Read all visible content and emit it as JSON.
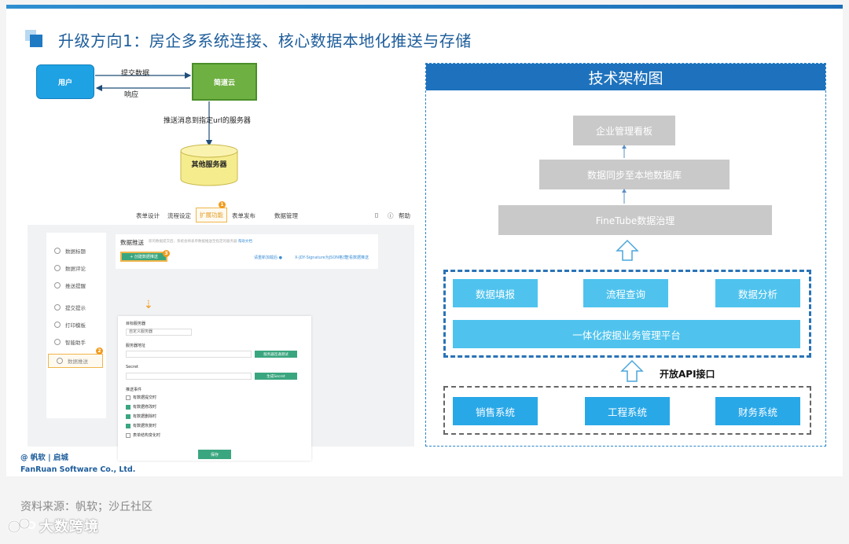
{
  "slide": {
    "title": "升级方向1：房企多系统连接、核心数据本地化推送与存储"
  },
  "flow": {
    "user": "用户",
    "cloud": "简道云",
    "submit": "提交数据",
    "response": "响应",
    "push": "推送消息到指定url的服务器",
    "server": "其他服务器"
  },
  "screenshot": {
    "tabs": [
      "表单设计",
      "流程设定",
      "扩展功能",
      "表单发布",
      "数据管理"
    ],
    "help": "帮助",
    "badge1": "1",
    "badge2": "2",
    "badge3": "3",
    "side_items": [
      "数据标题",
      "数据评论",
      "推送提醒",
      "提交提示",
      "打印模板",
      "智能助手",
      "数据推送"
    ],
    "panel_title": "数据推送",
    "panel_desc": "新的数据提交后，系统会将表单数据推送至指定的服务器",
    "panel_desc_link": "帮助文档",
    "push_button": "+ 创建数据推送",
    "panel_links": [
      "请重新加载后 ●",
      "X-JDY-Signature为JSON格式",
      "查看数据推送"
    ],
    "form": {
      "server_label": "目标服务器",
      "server_value": "自定义服务器",
      "url_label": "服务器地址",
      "test_button": "服务器连通测试",
      "secret_label": "Secret",
      "secret_button": "生成Secret",
      "events_label": "推送事件",
      "events": [
        {
          "label": "有数据提交时",
          "checked": false
        },
        {
          "label": "有数据修改时",
          "checked": true
        },
        {
          "label": "有数据删除时",
          "checked": true
        },
        {
          "label": "有数据恢复时",
          "checked": true
        },
        {
          "label": "表单结构变化时",
          "checked": false
        }
      ],
      "save": "保存"
    }
  },
  "brand": {
    "line1": "@ 帆软 | 启城",
    "line2": "FanRuan  Software Co., Ltd."
  },
  "architecture": {
    "header": "技术架构图",
    "top_layers": [
      "企业管理看板",
      "数据同步至本地数据库",
      "FineTube数据治理"
    ],
    "platform_modules": [
      "数据填报",
      "流程查询",
      "数据分析"
    ],
    "platform": "一体化按据业务管理平台",
    "api": "开放API接口",
    "systems": [
      "销售系统",
      "工程系统",
      "财务系统"
    ]
  },
  "footer": {
    "source": "资料来源：帆软；沙丘社区",
    "watermark": "大数跨境"
  },
  "colors": {
    "title_blue": "#1d5d9b",
    "header_blue": "#1e72bd",
    "module_blue": "#4fc3ee",
    "layer_gray": "#c9c9c9",
    "user_blue": "#1ea2e4",
    "cloud_green": "#6fb043",
    "server_yellow": "#f5ec8e"
  }
}
